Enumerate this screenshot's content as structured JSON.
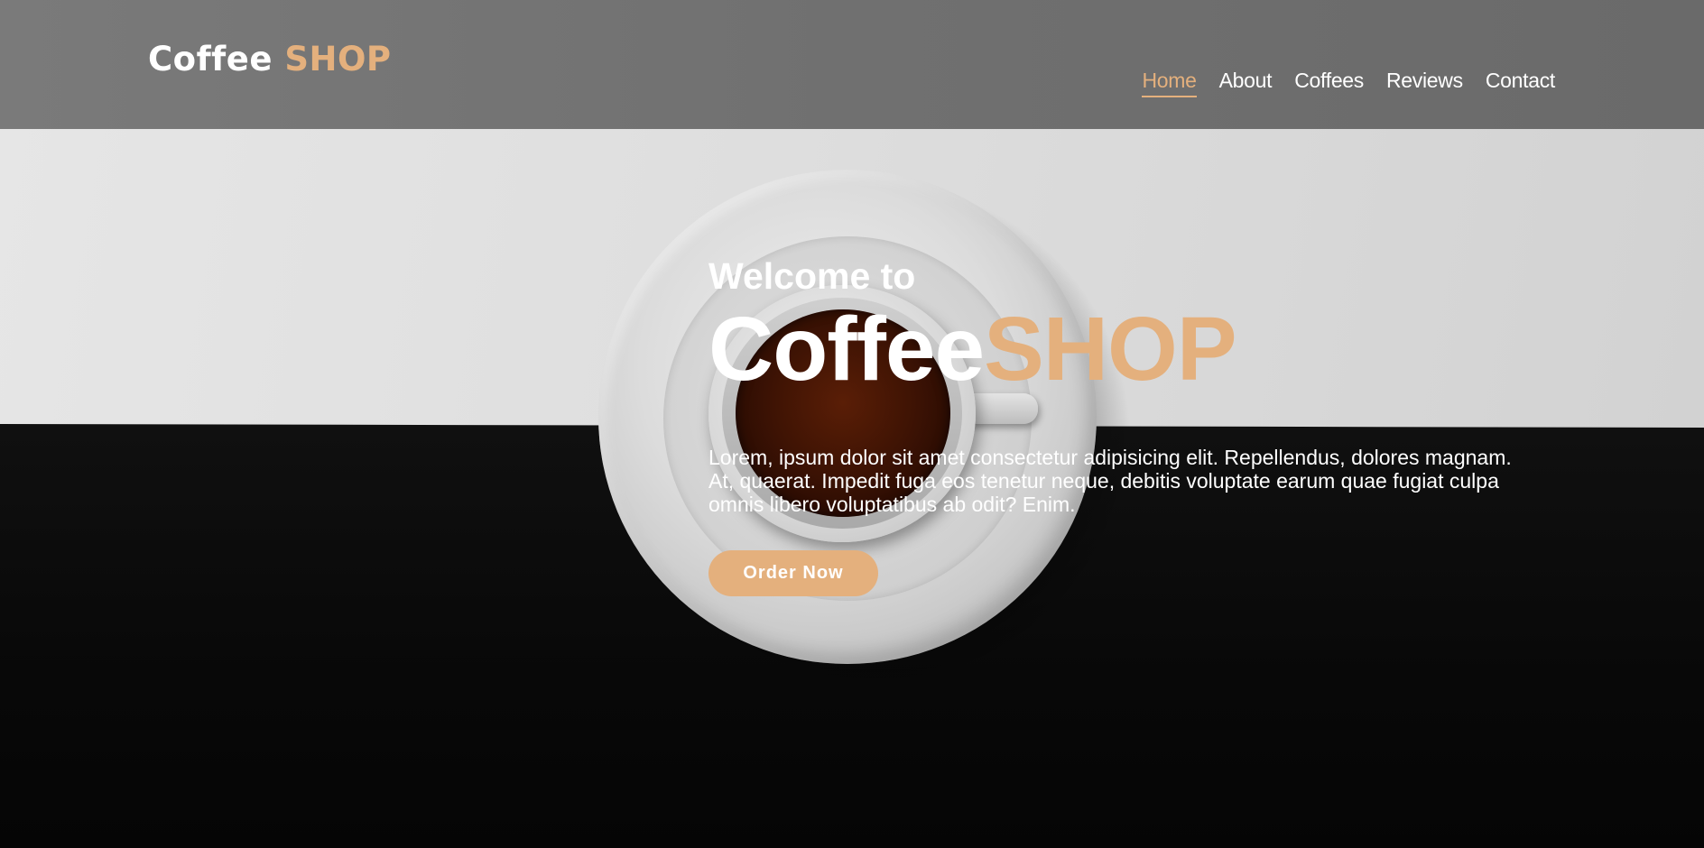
{
  "header": {
    "logo": {
      "part1": "Coffee",
      "part2": "SHOP"
    },
    "nav": [
      {
        "label": "Home",
        "active": true
      },
      {
        "label": "About",
        "active": false
      },
      {
        "label": "Coffees",
        "active": false
      },
      {
        "label": "Reviews",
        "active": false
      },
      {
        "label": "Contact",
        "active": false
      }
    ]
  },
  "hero": {
    "welcome": "Welcome to",
    "title_part1": "Coffee",
    "title_part2": "SHOP",
    "description": "Lorem, ipsum dolor sit amet consectetur adipisicing elit. Repellendus, dolores magnam. At, quaerat. Impedit fuga eos tenetur neque, debitis voluptate earum quae fugiat culpa omnis libero voluptatibus ab odit? Enim.",
    "cta_label": "Order Now"
  },
  "colors": {
    "accent": "#e4b07d",
    "header_bg": "#707070",
    "text": "#ffffff"
  }
}
